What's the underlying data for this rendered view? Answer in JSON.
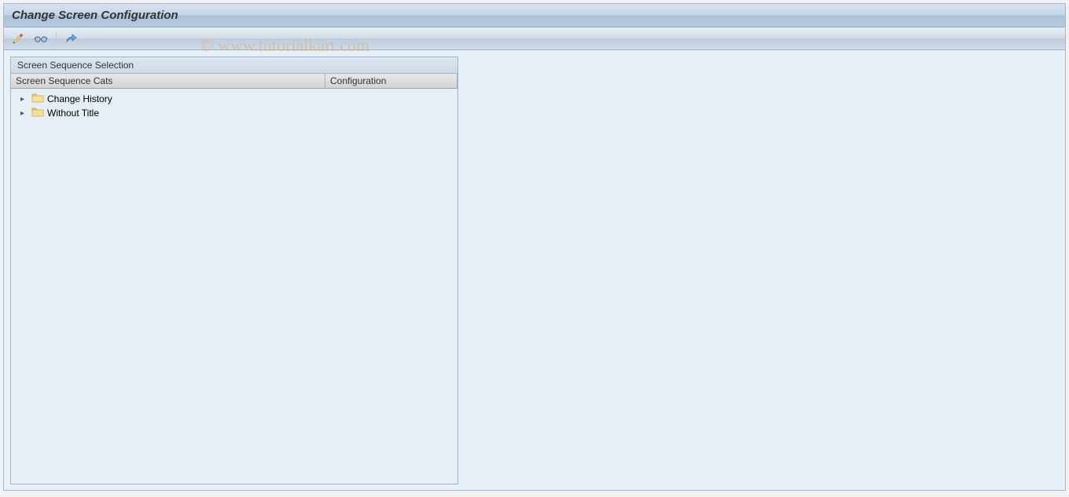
{
  "app": {
    "title": "Change Screen Configuration"
  },
  "toolbar": {
    "icons": {
      "tool1": "pencil-edit-icon",
      "tool2": "glasses-display-icon",
      "tool3": "expand-icon"
    }
  },
  "panel": {
    "title": "Screen Sequence Selection",
    "columns": {
      "col1": "Screen Sequence Cats",
      "col2": "Configuration"
    },
    "tree": [
      {
        "label": "Change History"
      },
      {
        "label": "Without Title"
      }
    ]
  },
  "watermark": "© www.tutorialkart.com"
}
